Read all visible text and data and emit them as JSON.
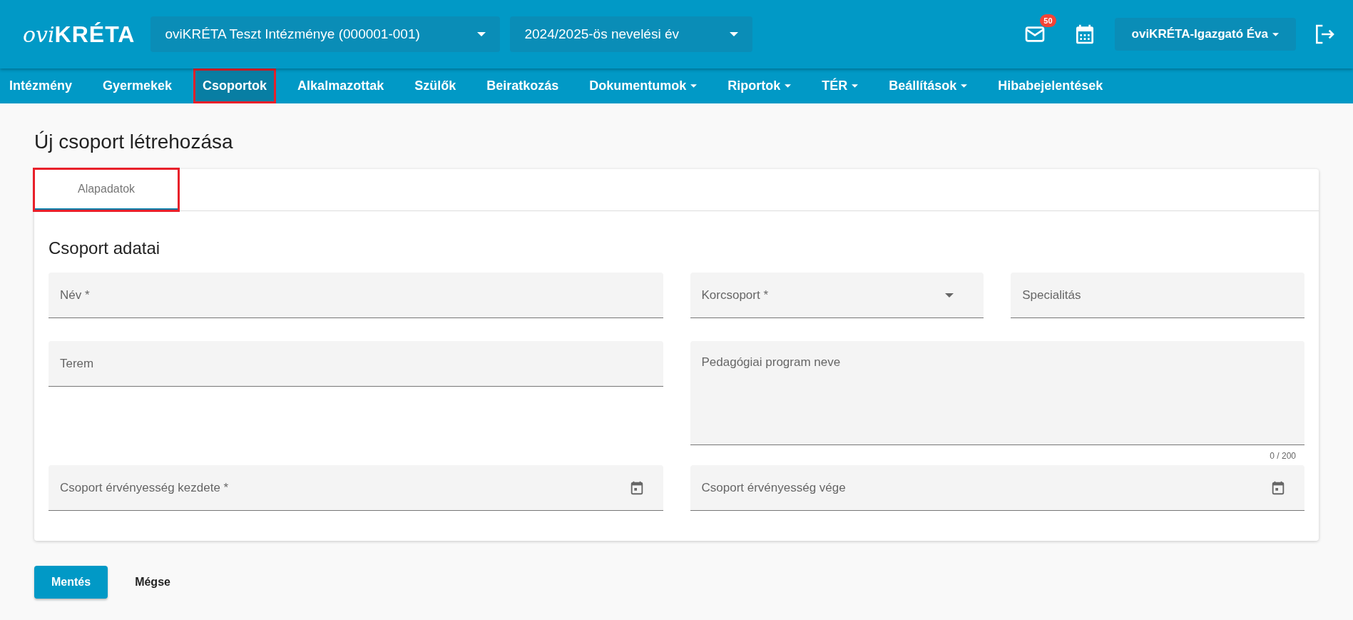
{
  "header": {
    "logo": {
      "prefix": "ovi",
      "name": "KRÉTA"
    },
    "institution_select": {
      "value": "oviKRÉTA Teszt Intézménye (000001-001)"
    },
    "year_select": {
      "value": "2024/2025-ös nevelési év"
    },
    "mail_badge": "50",
    "user_menu": {
      "label": "oviKRÉTA-Igazgató Éva"
    }
  },
  "nav": [
    {
      "label": "Intézmény",
      "dropdown": false,
      "selected": false,
      "highlighted": false
    },
    {
      "label": "Gyermekek",
      "dropdown": false,
      "selected": false,
      "highlighted": false
    },
    {
      "label": "Csoportok",
      "dropdown": false,
      "selected": true,
      "highlighted": true
    },
    {
      "label": "Alkalmazottak",
      "dropdown": false,
      "selected": false,
      "highlighted": false
    },
    {
      "label": "Szülők",
      "dropdown": false,
      "selected": false,
      "highlighted": false
    },
    {
      "label": "Beiratkozás",
      "dropdown": false,
      "selected": false,
      "highlighted": false
    },
    {
      "label": "Dokumentumok",
      "dropdown": true,
      "selected": false,
      "highlighted": false
    },
    {
      "label": "Riportok",
      "dropdown": true,
      "selected": false,
      "highlighted": false
    },
    {
      "label": "TÉR",
      "dropdown": true,
      "selected": false,
      "highlighted": false
    },
    {
      "label": "Beállítások",
      "dropdown": true,
      "selected": false,
      "highlighted": false
    },
    {
      "label": "Hibabejelentések",
      "dropdown": false,
      "selected": false,
      "highlighted": false
    }
  ],
  "page_title": "Új csoport létrehozása",
  "tabs": [
    {
      "label": "Alapadatok",
      "selected": true,
      "highlighted": true
    }
  ],
  "section_title": "Csoport adatai",
  "form_rows": [
    {
      "fields": [
        {
          "kind": "text",
          "placeholder": "Név *"
        },
        {
          "kind": "select",
          "placeholder": "Korcsoport *"
        },
        {
          "kind": "text",
          "placeholder": "Specialitás"
        }
      ]
    },
    {
      "fields": [
        {
          "kind": "text",
          "placeholder": "Terem"
        },
        {
          "kind": "textarea",
          "placeholder": "Pedagógiai program neve",
          "counter": "0 / 200"
        }
      ]
    },
    {
      "fields": [
        {
          "kind": "date",
          "placeholder": "Csoport érvényesség kezdete *"
        },
        {
          "kind": "date",
          "placeholder": "Csoport érvényesség vége"
        }
      ]
    }
  ],
  "buttons": [
    {
      "kind": "primary",
      "label": "Mentés"
    },
    {
      "kind": "text",
      "label": "Mégse"
    }
  ]
}
